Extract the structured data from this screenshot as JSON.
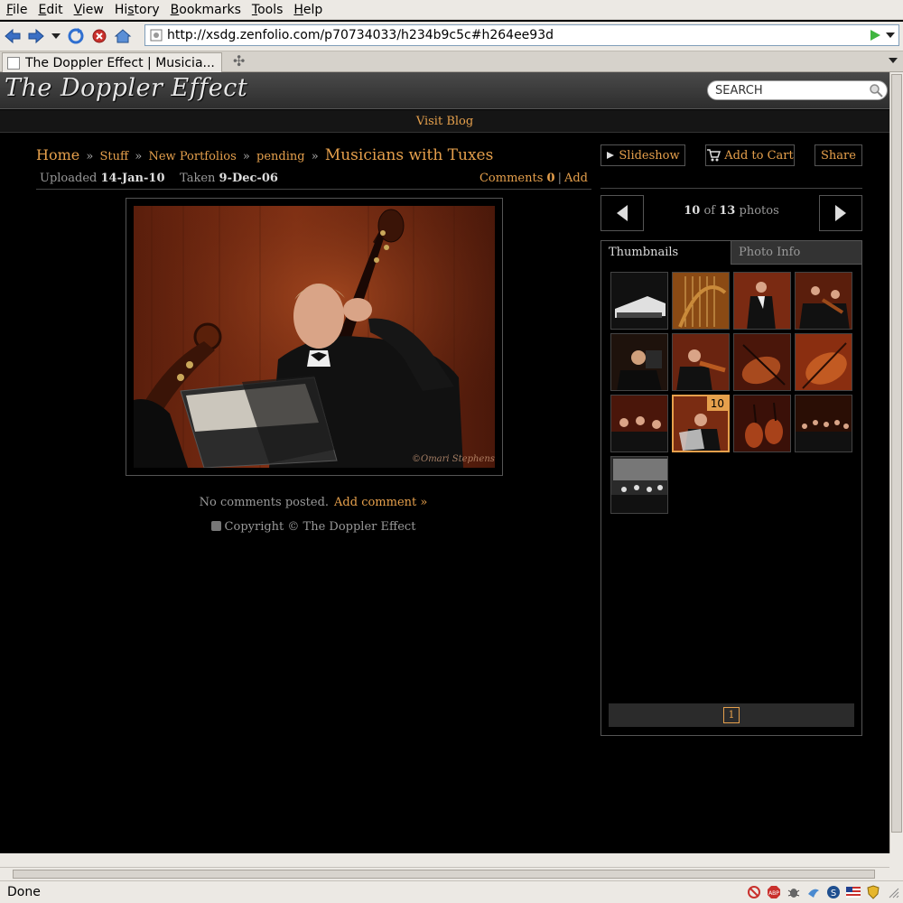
{
  "browser": {
    "menu": [
      {
        "label": "File",
        "key": "F",
        "rest": "ile"
      },
      {
        "label": "Edit",
        "key": "E",
        "rest": "dit"
      },
      {
        "label": "View",
        "key": "V",
        "rest": "iew"
      },
      {
        "label": "History",
        "key": "s",
        "pre": "Hi",
        "rest": "tory"
      },
      {
        "label": "Bookmarks",
        "key": "B",
        "rest": "ookmarks"
      },
      {
        "label": "Tools",
        "key": "T",
        "rest": "ools"
      },
      {
        "label": "Help",
        "key": "H",
        "rest": "elp"
      }
    ],
    "url": "http://xsdg.zenfolio.com/p70734033/h234b9c5c#h264ee93d",
    "tab_title": "The Doppler Effect | Musicia...",
    "status": "Done",
    "colors": {
      "chrome": "#ece9e4",
      "accent": "#e6a04c"
    }
  },
  "site": {
    "title": "The Doppler Effect",
    "search_placeholder": "SEARCH",
    "blog_link": "Visit Blog"
  },
  "breadcrumb": {
    "home": "Home",
    "items": [
      "Stuff",
      "New Portfolios",
      "pending"
    ],
    "separator": "»",
    "current": "Musicians with Tuxes"
  },
  "meta": {
    "uploaded_label": "Uploaded",
    "uploaded_date": "14-Jan-10",
    "taken_label": "Taken",
    "taken_date": "9-Dec-06",
    "comments_label": "Comments",
    "comments_count": "0",
    "add_label": "Add"
  },
  "photo": {
    "watermark": "©Omari Stephens"
  },
  "comments": {
    "none_text": "No comments posted.",
    "add_link": "Add comment »",
    "copyright": "Copyright © The Doppler Effect"
  },
  "actions": {
    "slideshow": "Slideshow",
    "add_to_cart": "Add to Cart",
    "share": "Share"
  },
  "pager": {
    "current": "10",
    "of_label": "of",
    "total": "13",
    "unit": "photos"
  },
  "panel": {
    "tab_thumbnails": "Thumbnails",
    "tab_photo_info": "Photo Info",
    "active_badge": "10",
    "page_number": "1"
  }
}
